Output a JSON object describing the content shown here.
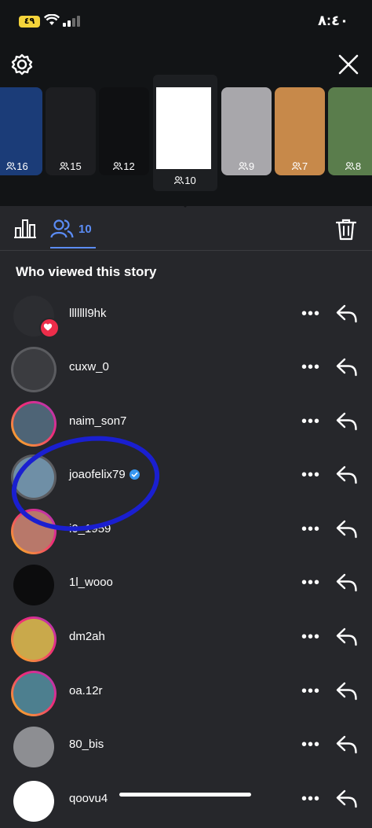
{
  "status": {
    "battery": "٤٩",
    "time": "٨:٤٠"
  },
  "thumbs": [
    {
      "count": "16",
      "bg": "#1b3c78"
    },
    {
      "count": "15",
      "bg": "#1d1e21"
    },
    {
      "count": "12",
      "bg": "#0f1012"
    },
    {
      "count": "10",
      "bg": "#ffffff",
      "selected": true
    },
    {
      "count": "9",
      "bg": "#a8a7ab"
    },
    {
      "count": "7",
      "bg": "#c7894a"
    },
    {
      "count": "8",
      "bg": "#5a7d4c"
    }
  ],
  "tabs": {
    "viewers_count": "10"
  },
  "heading": "Who viewed this story",
  "viewers": [
    {
      "username": "lllllll9hk",
      "ring": "none",
      "avatar_color": "#2c2d31",
      "liked": true
    },
    {
      "username": "cuxw_0",
      "ring": "seen",
      "avatar_color": "#3b3c40"
    },
    {
      "username": "naim_son7",
      "ring": "story",
      "avatar_color": "#4e6476"
    },
    {
      "username": "joaofelix79",
      "ring": "seen",
      "avatar_color": "#6f8fa6",
      "verified": true
    },
    {
      "username": "i0_1959",
      "ring": "story",
      "avatar_color": "#b8786a"
    },
    {
      "username": "1l_wooo",
      "ring": "none",
      "avatar_color": "#0c0c0d"
    },
    {
      "username": "dm2ah",
      "ring": "story",
      "avatar_color": "#c9a94b"
    },
    {
      "username": "oa.12r",
      "ring": "story",
      "avatar_color": "#4d7f8f"
    },
    {
      "username": "80_bis",
      "ring": "none",
      "avatar_color": "#8d8e92"
    },
    {
      "username": "qoovu4",
      "ring": "none",
      "avatar_color": "#ffffff"
    }
  ],
  "colors": {
    "accent": "#5b8cf5",
    "annotation": "#1a1fd0"
  }
}
